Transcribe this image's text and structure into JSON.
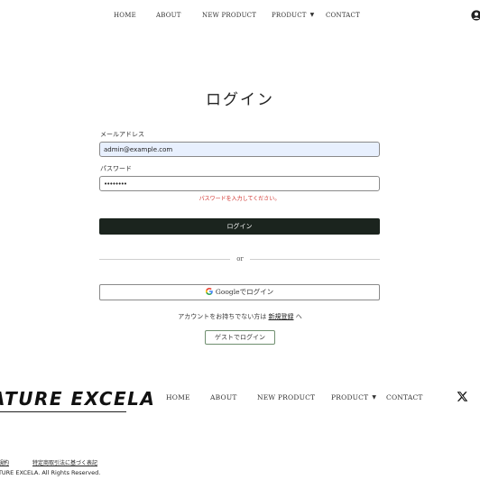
{
  "header": {
    "nav": [
      {
        "label": "HOME"
      },
      {
        "label": "ABOUT"
      },
      {
        "label": "NEW PRODUCT"
      },
      {
        "label": "PRODUCT"
      },
      {
        "label": "CONTACT"
      }
    ],
    "user_icon": "user-icon"
  },
  "login": {
    "title": "ログイン",
    "email_label": "メールアドレス",
    "email_value": "admin@example.com",
    "password_label": "パスワード",
    "password_value": "••••••••",
    "password_error": "パスワードを入力してください。",
    "submit_label": "ログイン",
    "divider_text": "or",
    "google_label": "Googleでログイン",
    "signup_prefix": "アカウントをお持ちでない方は",
    "signup_link": "新規登録",
    "signup_suffix": "へ",
    "guest_label": "ゲストでログイン"
  },
  "footer": {
    "logo_text": "ATURE EXCELA",
    "nav": [
      {
        "label": "HOME"
      },
      {
        "label": "ABOUT"
      },
      {
        "label": "NEW PRODUCT"
      },
      {
        "label": "PRODUCT"
      },
      {
        "label": "CONTACT"
      }
    ],
    "social_icon": "x-icon",
    "legal_links": [
      {
        "label": "規約"
      },
      {
        "label": "特定商取引法に基づく表記"
      }
    ],
    "copyright": "ATURE EXCELA. All Rights Reserved."
  },
  "colors": {
    "primary_button": "#1b241e",
    "error": "#d0312d",
    "autofill_bg": "#e8f0fe"
  }
}
